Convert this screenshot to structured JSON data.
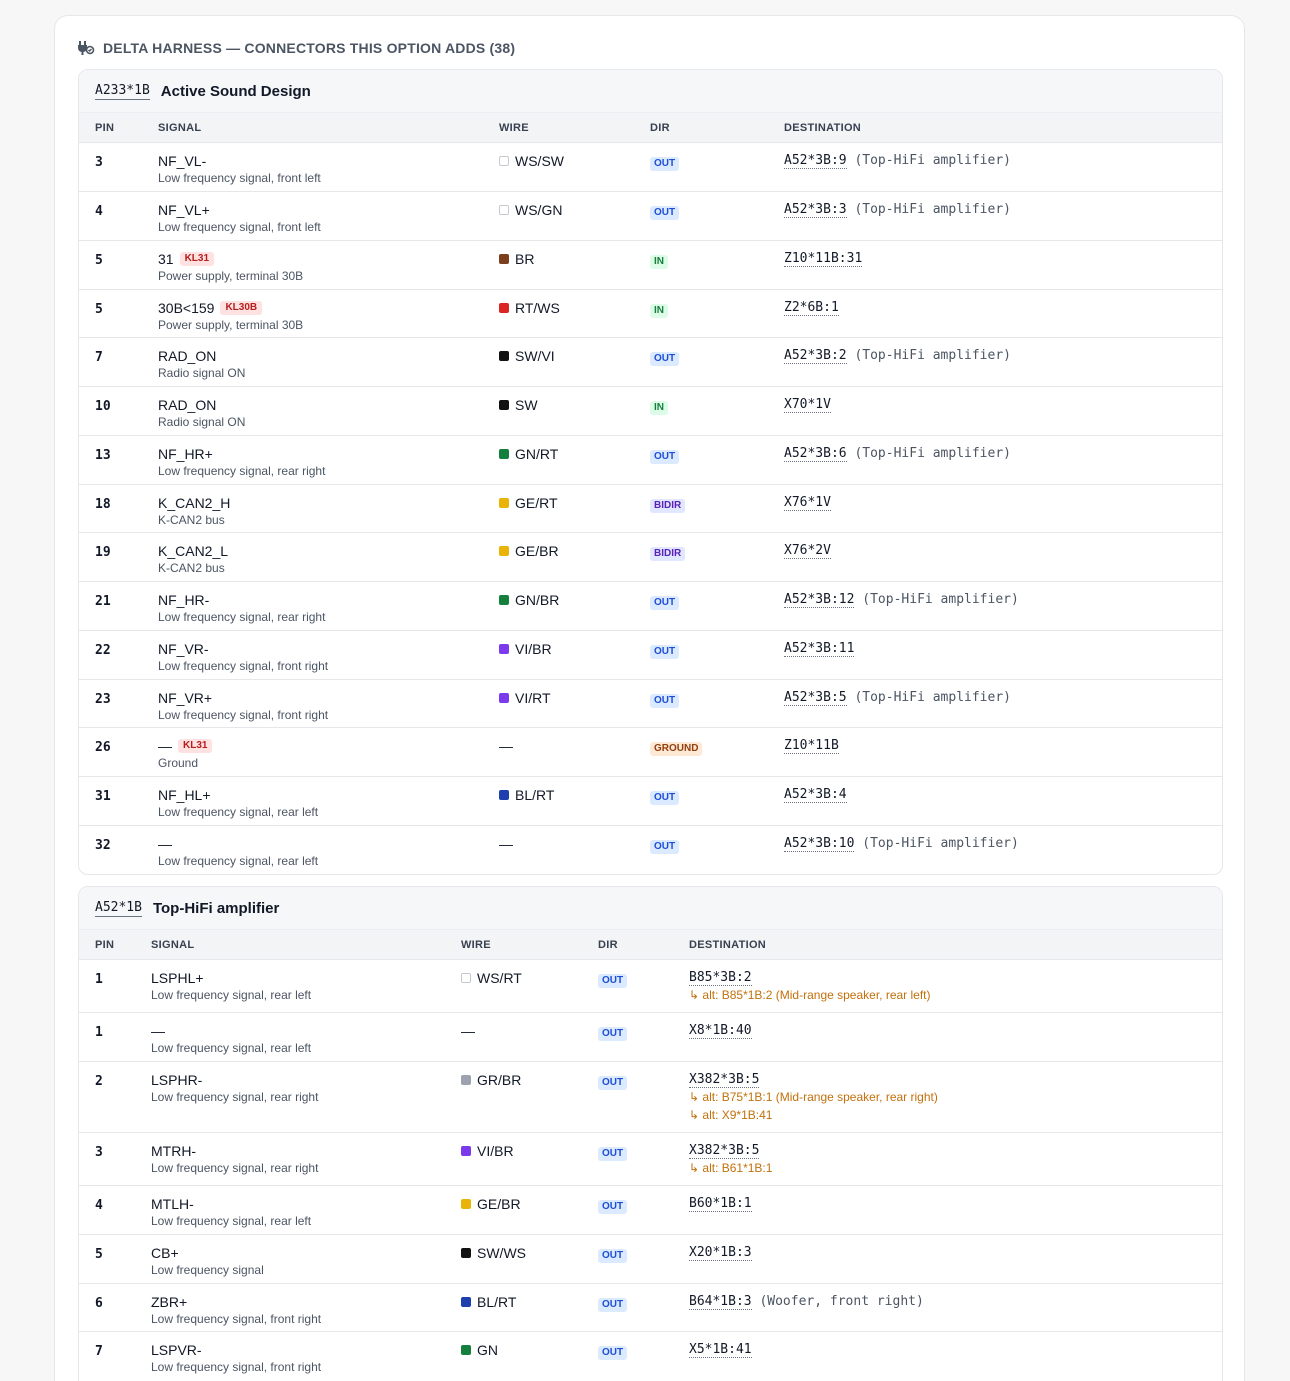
{
  "header": {
    "title": "DELTA HARNESS — CONNECTORS THIS OPTION ADDS (38)",
    "icon": "plug-icon"
  },
  "columns": {
    "pin": "PIN",
    "signal": "SIGNAL",
    "wire": "WIRE",
    "dir": "DIR",
    "destination": "DESTINATION"
  },
  "connectors": [
    {
      "id": "A233*1B",
      "title": "Active Sound Design",
      "rows": [
        {
          "pin": "3",
          "name": "NF_VL-",
          "desc": "Low frequency signal, front left",
          "wire": "WS/SW",
          "color": "#ffffff",
          "light": true,
          "dir": "OUT",
          "dest": "A52*3B:9",
          "note": "(Top-HiFi amplifier)"
        },
        {
          "pin": "4",
          "name": "NF_VL+",
          "desc": "Low frequency signal, front left",
          "wire": "WS/GN",
          "color": "#ffffff",
          "light": true,
          "dir": "OUT",
          "dest": "A52*3B:3",
          "note": "(Top-HiFi amplifier)"
        },
        {
          "pin": "5",
          "name": "31",
          "badge": "KL31",
          "desc": "Power supply, terminal 30B",
          "wire": "BR",
          "color": "#7c3f1d",
          "dir": "IN",
          "dest": "Z10*11B:31",
          "note": ""
        },
        {
          "pin": "5",
          "name": "30B<159",
          "badge": "KL30B",
          "desc": "Power supply, terminal 30B",
          "wire": "RT/WS",
          "color": "#dc2626",
          "dir": "IN",
          "dest": "Z2*6B:1",
          "note": ""
        },
        {
          "pin": "7",
          "name": "RAD_ON",
          "desc": "Radio signal ON",
          "wire": "SW/VI",
          "color": "#111111",
          "dir": "OUT",
          "dest": "A52*3B:2",
          "note": "(Top-HiFi amplifier)"
        },
        {
          "pin": "10",
          "name": "RAD_ON",
          "desc": "Radio signal ON",
          "wire": "SW",
          "color": "#111111",
          "dir": "IN",
          "dest": "X70*1V",
          "note": ""
        },
        {
          "pin": "13",
          "name": "NF_HR+",
          "desc": "Low frequency signal, rear right",
          "wire": "GN/RT",
          "color": "#15803d",
          "dir": "OUT",
          "dest": "A52*3B:6",
          "note": "(Top-HiFi amplifier)"
        },
        {
          "pin": "18",
          "name": "K_CAN2_H",
          "desc": "K-CAN2 bus",
          "wire": "GE/RT",
          "color": "#eab308",
          "dir": "BIDIR",
          "dest": "X76*1V",
          "note": ""
        },
        {
          "pin": "19",
          "name": "K_CAN2_L",
          "desc": "K-CAN2 bus",
          "wire": "GE/BR",
          "color": "#eab308",
          "dir": "BIDIR",
          "dest": "X76*2V",
          "note": ""
        },
        {
          "pin": "21",
          "name": "NF_HR-",
          "desc": "Low frequency signal, rear right",
          "wire": "GN/BR",
          "color": "#15803d",
          "dir": "OUT",
          "dest": "A52*3B:12",
          "note": "(Top-HiFi amplifier)"
        },
        {
          "pin": "22",
          "name": "NF_VR-",
          "desc": "Low frequency signal, front right",
          "wire": "VI/BR",
          "color": "#7c3aed",
          "dir": "OUT",
          "dest": "A52*3B:11",
          "note": ""
        },
        {
          "pin": "23",
          "name": "NF_VR+",
          "desc": "Low frequency signal, front right",
          "wire": "VI/RT",
          "color": "#7c3aed",
          "dir": "OUT",
          "dest": "A52*3B:5",
          "note": "(Top-HiFi amplifier)"
        },
        {
          "pin": "26",
          "name": "—",
          "badge": "KL31",
          "desc": "Ground",
          "wire": "—",
          "color": "",
          "dir": "GROUND",
          "dest": "Z10*11B",
          "note": ""
        },
        {
          "pin": "31",
          "name": "NF_HL+",
          "desc": "Low frequency signal, rear left",
          "wire": "BL/RT",
          "color": "#1e40af",
          "dir": "OUT",
          "dest": "A52*3B:4",
          "note": ""
        },
        {
          "pin": "32",
          "name": "—",
          "desc": "Low frequency signal, rear left",
          "wire": "—",
          "color": "",
          "dir": "OUT",
          "dest": "A52*3B:10",
          "note": "(Top-HiFi amplifier)"
        }
      ]
    },
    {
      "id": "A52*1B",
      "title": "Top-HiFi amplifier",
      "rows": [
        {
          "pin": "1",
          "name": "LSPHL+",
          "desc": "Low frequency signal, rear left",
          "wire": "WS/RT",
          "color": "#ffffff",
          "light": true,
          "dir": "OUT",
          "dest": "B85*3B:2",
          "note": "",
          "alts": [
            "↳ alt: B85*1B:2 (Mid-range speaker, rear left)"
          ]
        },
        {
          "pin": "1",
          "name": "—",
          "desc": "Low frequency signal, rear left",
          "wire": "—",
          "color": "",
          "dir": "OUT",
          "dest": "X8*1B:40",
          "note": ""
        },
        {
          "pin": "2",
          "name": "LSPHR-",
          "desc": "Low frequency signal, rear right",
          "wire": "GR/BR",
          "color": "#9ca3af",
          "dir": "OUT",
          "dest": "X382*3B:5",
          "note": "",
          "alts": [
            "↳ alt: B75*1B:1 (Mid-range speaker, rear right)",
            "↳ alt: X9*1B:41"
          ]
        },
        {
          "pin": "3",
          "name": "MTRH-",
          "desc": "Low frequency signal, rear right",
          "wire": "VI/BR",
          "color": "#7c3aed",
          "dir": "OUT",
          "dest": "X382*3B:5",
          "note": "",
          "alts": [
            "↳ alt: B61*1B:1"
          ]
        },
        {
          "pin": "4",
          "name": "MTLH-",
          "desc": "Low frequency signal, rear left",
          "wire": "GE/BR",
          "color": "#eab308",
          "dir": "OUT",
          "dest": "B60*1B:1",
          "note": ""
        },
        {
          "pin": "5",
          "name": "CB+",
          "desc": "Low frequency signal",
          "wire": "SW/WS",
          "color": "#111111",
          "dir": "OUT",
          "dest": "X20*1B:3",
          "note": ""
        },
        {
          "pin": "6",
          "name": "ZBR+",
          "desc": "Low frequency signal, front right",
          "wire": "BL/RT",
          "color": "#1e40af",
          "dir": "OUT",
          "dest": "B64*1B:3",
          "note": "(Woofer, front right)"
        },
        {
          "pin": "7",
          "name": "LSPVR-",
          "desc": "Low frequency signal, front right",
          "wire": "GN",
          "color": "#15803d",
          "dir": "OUT",
          "dest": "X5*1B:41",
          "note": ""
        }
      ]
    }
  ]
}
